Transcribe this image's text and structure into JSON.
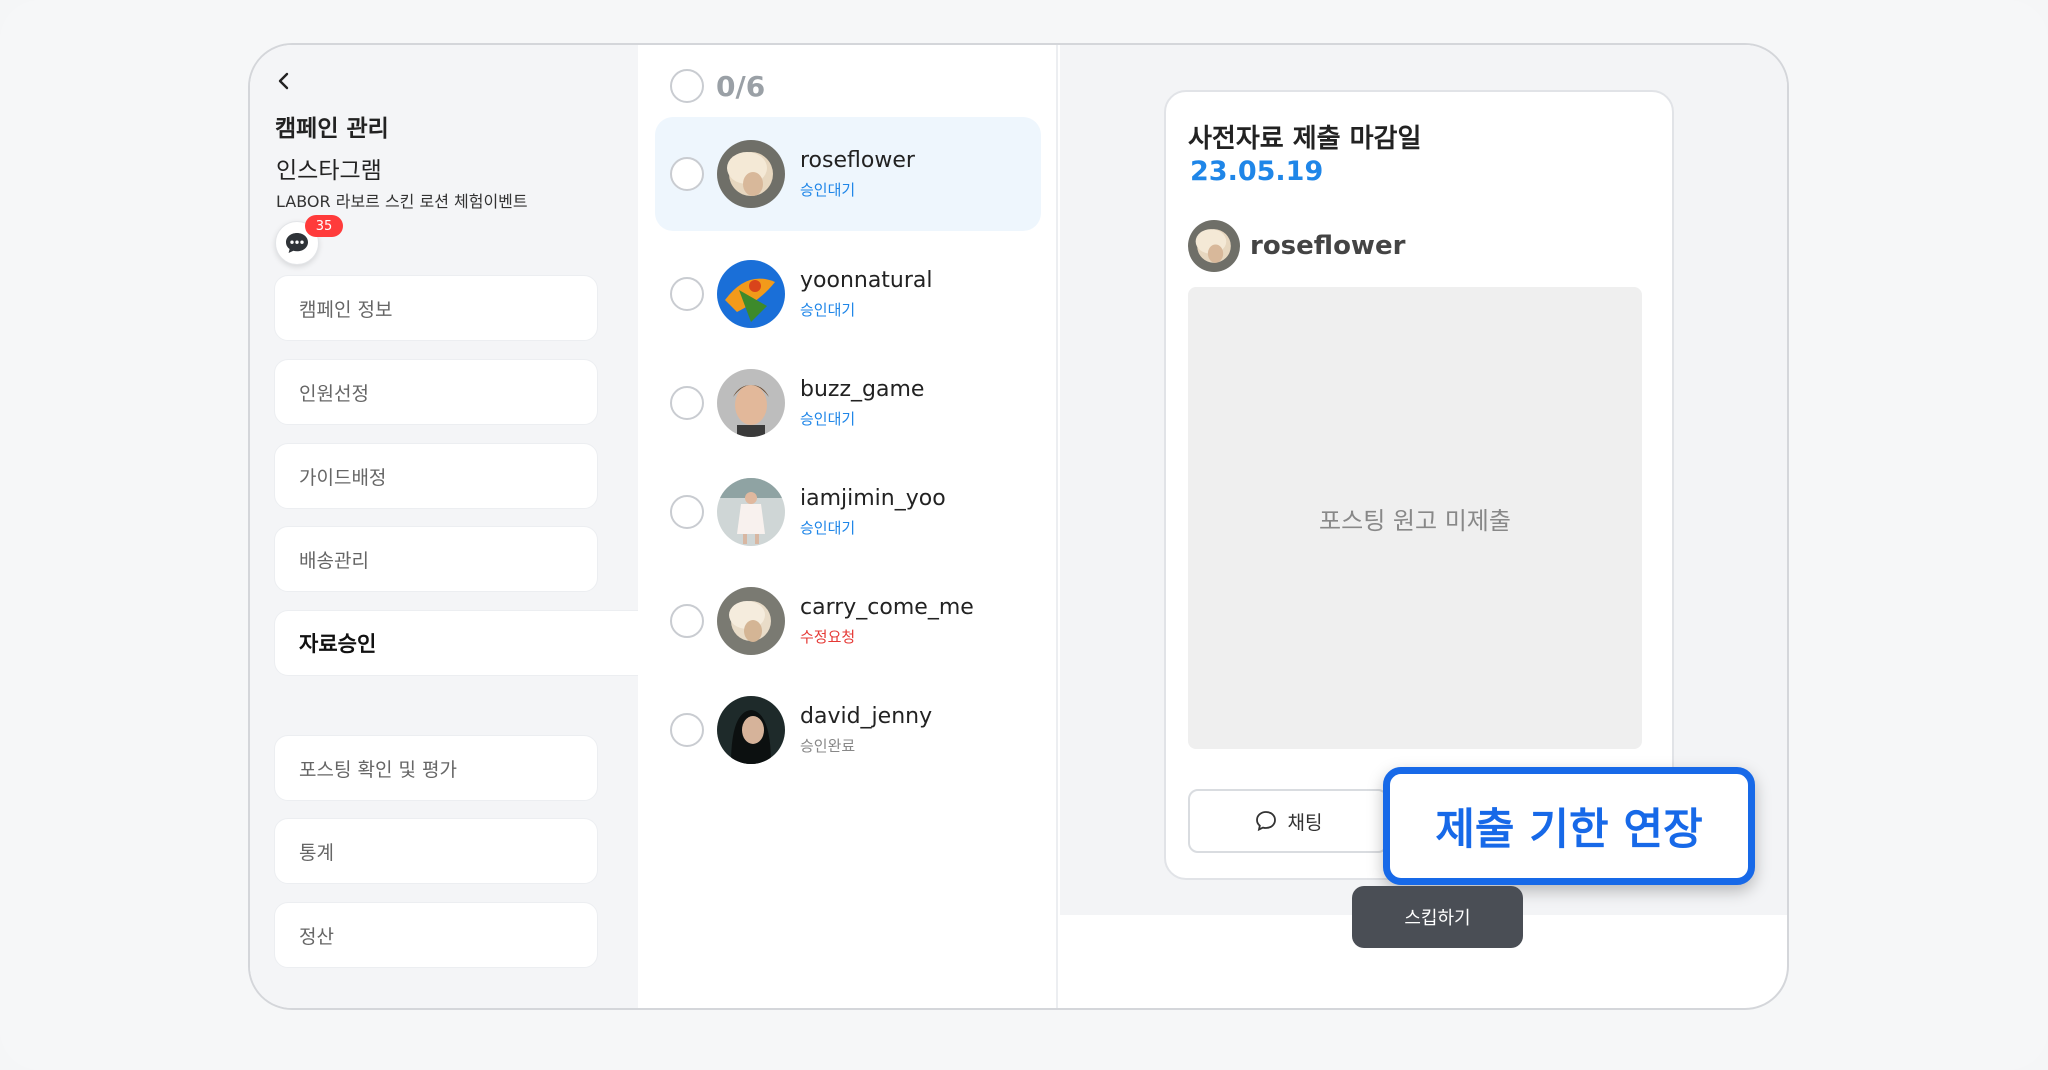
{
  "sidebar": {
    "title": "캠페인 관리",
    "platform": "인스타그램",
    "campaign_name": "LABOR 라보르 스킨 로션 체험이벤트",
    "chat_badge": "35",
    "menu": [
      {
        "label": "캠페인 정보",
        "active": false
      },
      {
        "label": "인원선정",
        "active": false
      },
      {
        "label": "가이드배정",
        "active": false
      },
      {
        "label": "배송관리",
        "active": false
      },
      {
        "label": "자료승인",
        "active": true
      },
      {
        "label": "포스팅 확인 및 평가",
        "active": false
      },
      {
        "label": "통계",
        "active": false
      },
      {
        "label": "정산",
        "active": false
      }
    ]
  },
  "list": {
    "counter": "0/6",
    "rows": [
      {
        "name": "roseflower",
        "status": "승인대기",
        "status_color": "#1f86e8"
      },
      {
        "name": "yoonnatural",
        "status": "승인대기",
        "status_color": "#1f86e8"
      },
      {
        "name": "buzz_game",
        "status": "승인대기",
        "status_color": "#1f86e8"
      },
      {
        "name": "iamjimin_yoo",
        "status": "승인대기",
        "status_color": "#1f86e8"
      },
      {
        "name": "carry_come_me",
        "status": "수정요청",
        "status_color": "#e53935"
      },
      {
        "name": "david_jenny",
        "status": "승인완료",
        "status_color": "#888888"
      }
    ]
  },
  "detail": {
    "deadline_label": "사전자료 제출 마감일",
    "deadline_date": "23.05.19",
    "username": "roseflower",
    "empty_text": "포스팅 원고 미제출",
    "chat_label": "채팅",
    "extend_label": "제출 기한 연장",
    "skip_label": "스킵하기"
  },
  "colors": {
    "accent": "#1769e8",
    "date_blue": "#1f86e8",
    "badge_red": "#ff3b3b",
    "skip_dark": "#4a4e55"
  }
}
